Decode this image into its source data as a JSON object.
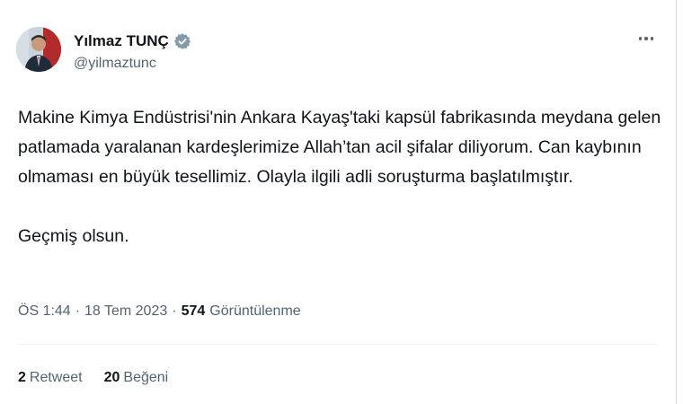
{
  "author": {
    "display_name": "Yılmaz TUNÇ",
    "handle": "@yilmaztunc",
    "verified_badge_color": "#829aab",
    "avatar_icon": "profile-photo"
  },
  "tweet": {
    "paragraphs": [
      "Makine Kimya Endüstrisi'nin Ankara Kayaş'taki kapsül fabrikasında meydana gelen patlamada yaralanan kardeşlerimize Allah’tan acil şifalar diliyorum. Can kaybının olmaması en büyük tesellimiz. Olayla ilgili adli soruşturma başlatılmıştır.",
      "Geçmiş olsun."
    ]
  },
  "meta": {
    "time": "ÖS 1:44",
    "separator": "·",
    "date": "18 Tem 2023",
    "views_count": "574",
    "views_label": "Görüntülenme"
  },
  "stats": {
    "retweets_count": "2",
    "retweets_label": "Retweet",
    "likes_count": "20",
    "likes_label": "Beğeni"
  },
  "icons": {
    "more": "more-icon",
    "verified": "verified-badge-icon"
  }
}
